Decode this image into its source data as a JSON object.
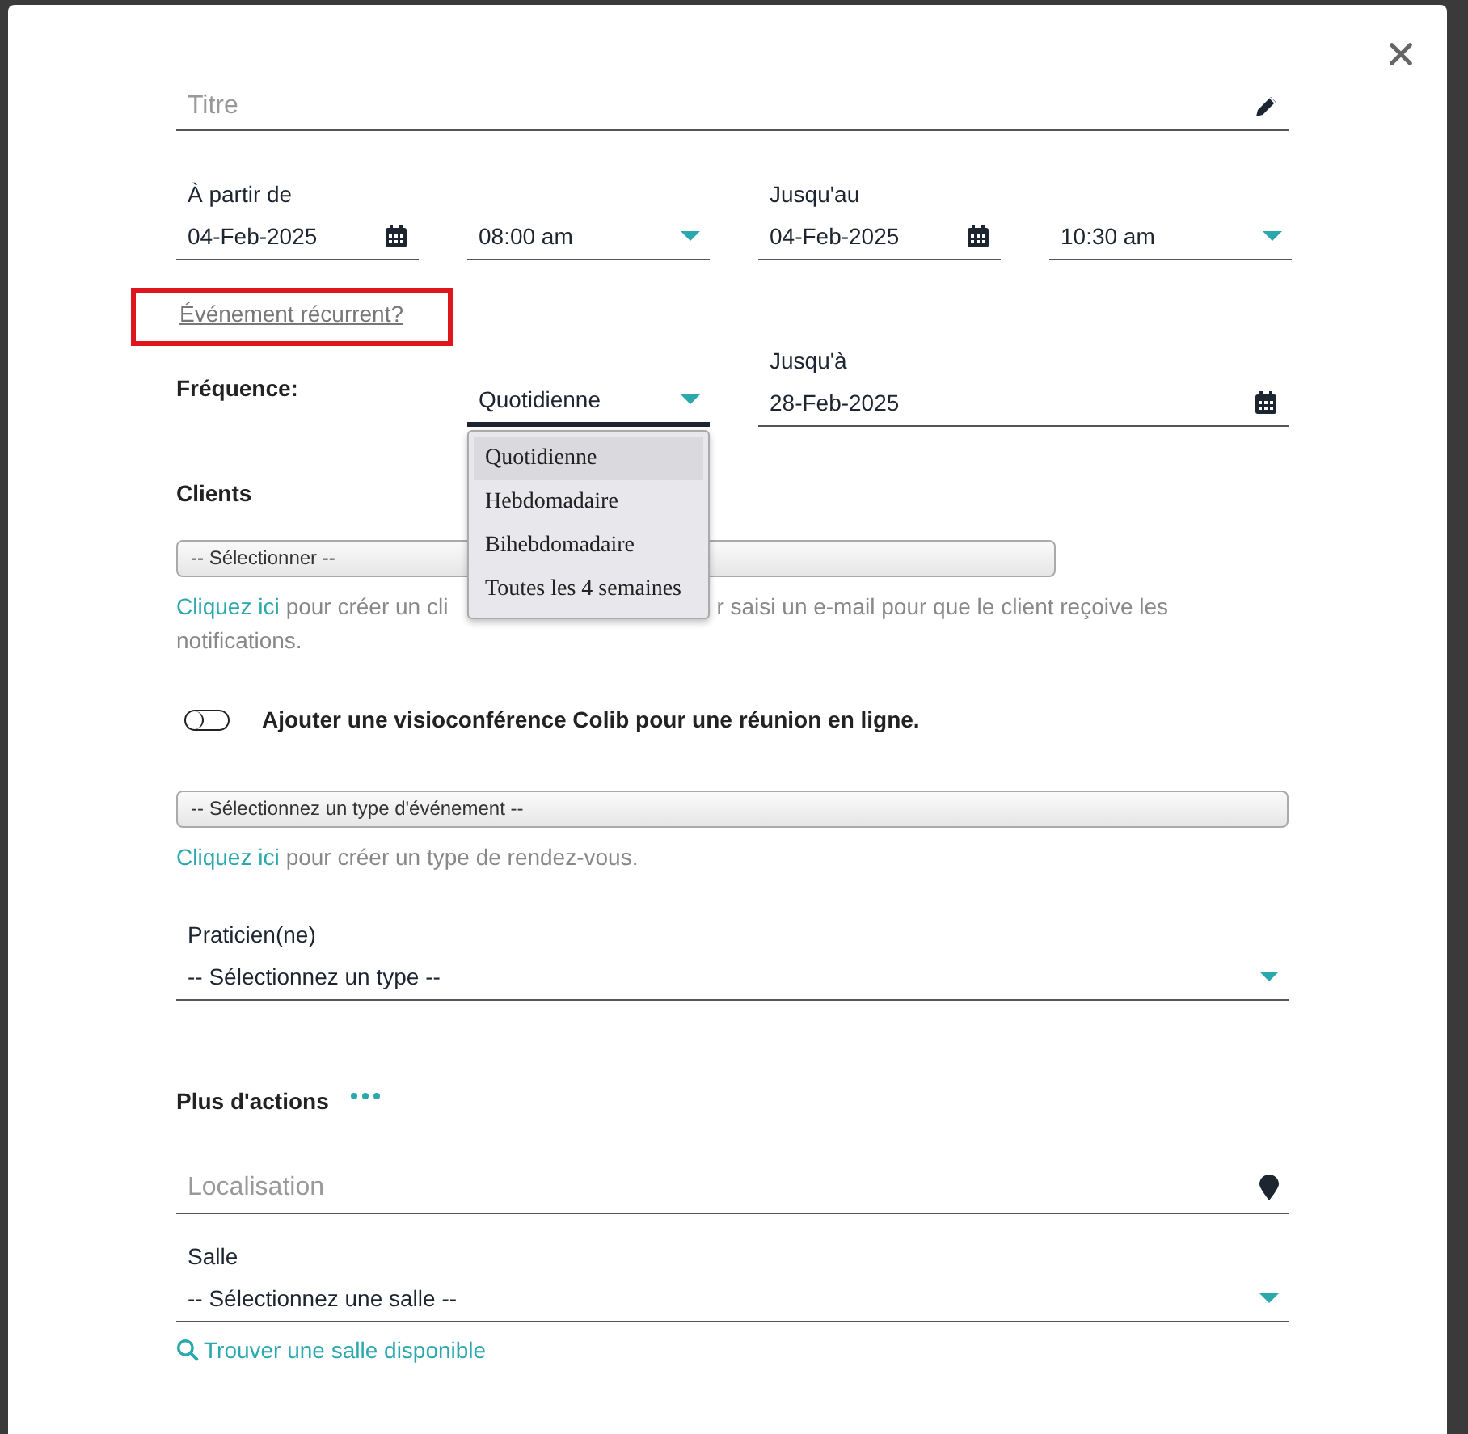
{
  "title_field": {
    "placeholder": "Titre"
  },
  "start": {
    "label": "À partir de",
    "date": "04-Feb-2025",
    "time": "08:00 am"
  },
  "end": {
    "label": "Jusqu'au",
    "date": "04-Feb-2025",
    "time": "10:30 am"
  },
  "recurrent_link": {
    "text": "Événement récurrent?",
    "highlighted": true
  },
  "frequency": {
    "label": "Fréquence:",
    "value": "Quotidienne",
    "expanded": true,
    "options": [
      {
        "label": "Quotidienne",
        "selected": true
      },
      {
        "label": "Hebdomadaire",
        "selected": false
      },
      {
        "label": "Bihebdomadaire",
        "selected": false
      },
      {
        "label": "Toutes les 4 semaines",
        "selected": false
      }
    ]
  },
  "until": {
    "label": "Jusqu'à",
    "date": "28-Feb-2025"
  },
  "clients": {
    "label": "Clients",
    "select": "-- Sélectionner --",
    "help_link": "Cliquez ici",
    "help_text_before": "pour créer un cli",
    "help_text_after": "r saisi un e-mail pour que le client reçoive les",
    "help_text_end": "notifications."
  },
  "video_toggle": {
    "label": "Ajouter une visioconférence Colib pour une réunion en ligne.",
    "on": false
  },
  "event_type": {
    "select": "-- Sélectionnez un type d'événement --",
    "help_link": "Cliquez ici",
    "help_text": "pour créer un type de rendez-vous."
  },
  "practitioner": {
    "label": "Praticien(ne)",
    "value": "-- Sélectionnez un type --"
  },
  "more_actions": {
    "label": "Plus d'actions"
  },
  "location_field": {
    "placeholder": "Localisation"
  },
  "room": {
    "label": "Salle",
    "value": "-- Sélectionnez une salle --"
  },
  "find_room_link": "Trouver une salle disponible"
}
